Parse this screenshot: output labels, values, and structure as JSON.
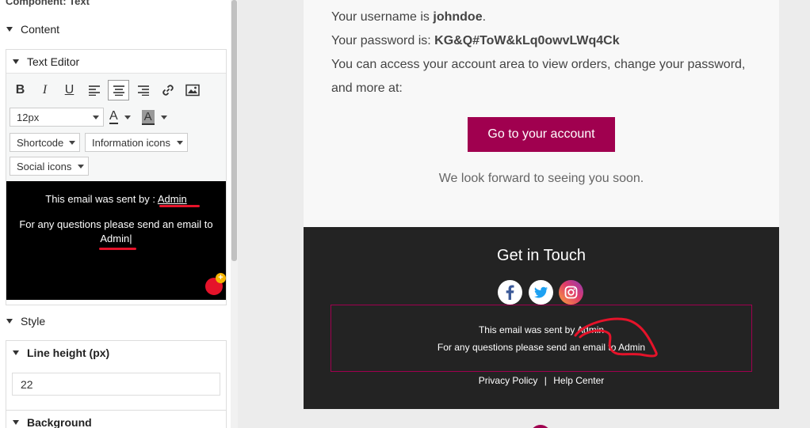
{
  "panel": {
    "component_title": "Component: Text",
    "content_label": "Content",
    "text_editor_label": "Text Editor",
    "font_size": "12px",
    "shortcode_label": "Shortcode",
    "info_icons_label": "Information icons",
    "social_icons_label": "Social icons",
    "editor": {
      "sent_by_text": "This email was sent by :",
      "sent_by_link": "Admin",
      "questions_text": "For any questions please send an email to",
      "questions_link": "Admin"
    },
    "style_label": "Style",
    "line_height_label": "Line height (px)",
    "line_height_value": "22",
    "background_label": "Background"
  },
  "preview": {
    "username_prefix": "Your username is ",
    "username": "johndoe",
    "username_suffix": ".",
    "password_prefix": "Your password is: ",
    "password": "KG&Q#ToW&kLq0owvLWq4Ck",
    "account_line1": "You can access your account area to view orders, change your password,",
    "account_line2": "and more at:",
    "cta_label": "Go to your account",
    "soon_text": "We look forward to seeing you soon.",
    "footer": {
      "title": "Get in Touch",
      "sent_by_text": "This email was sent by",
      "sent_by_link": "Admin",
      "questions_text": "For any questions please send an email to",
      "questions_link": "Admin",
      "privacy": "Privacy Policy",
      "separator": "|",
      "help": "Help Center"
    }
  },
  "colors": {
    "accent": "#a0004f",
    "annotation": "#e5132a",
    "footer_bg": "#232323"
  }
}
